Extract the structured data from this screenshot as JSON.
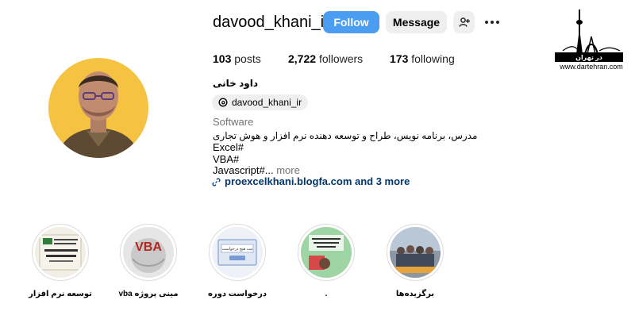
{
  "profile": {
    "username": "davood_khani_ir",
    "follow_label": "Follow",
    "message_label": "Message",
    "stats": {
      "posts_count": "103",
      "posts_label": "posts",
      "followers_count": "2,722",
      "followers_label": "followers",
      "following_count": "173",
      "following_label": "following"
    },
    "full_name": "داود خانی",
    "threads_handle": "davood_khani_ir",
    "category": "Software",
    "bio_lines": [
      "مدرس، برنامه نویس، طراح و توسعه دهنده نرم افزار و هوش تجاری",
      "Excel#",
      "VBA#",
      "Javascript#..."
    ],
    "bio_more": "more",
    "link_text": "proexcelkhani.blogfa.com and 3 more"
  },
  "watermark": {
    "logo_text": "در تهران",
    "site": "www.dartehran.com"
  },
  "highlights": [
    {
      "label": "توسعه نرم افزار"
    },
    {
      "label": "مینی پروژه vba",
      "thumb_text": "VBA"
    },
    {
      "label": "درخواست دوره",
      "thumb_text": "ثبت هیچ درخواست"
    },
    {
      "label": "."
    },
    {
      "label": "برگزیده‌ها"
    }
  ],
  "colors": {
    "follow_button": "#4a9df0",
    "secondary_button": "#efefef",
    "link": "#00376b",
    "muted_text": "#737373",
    "avatar_bg": "#f5c242"
  }
}
